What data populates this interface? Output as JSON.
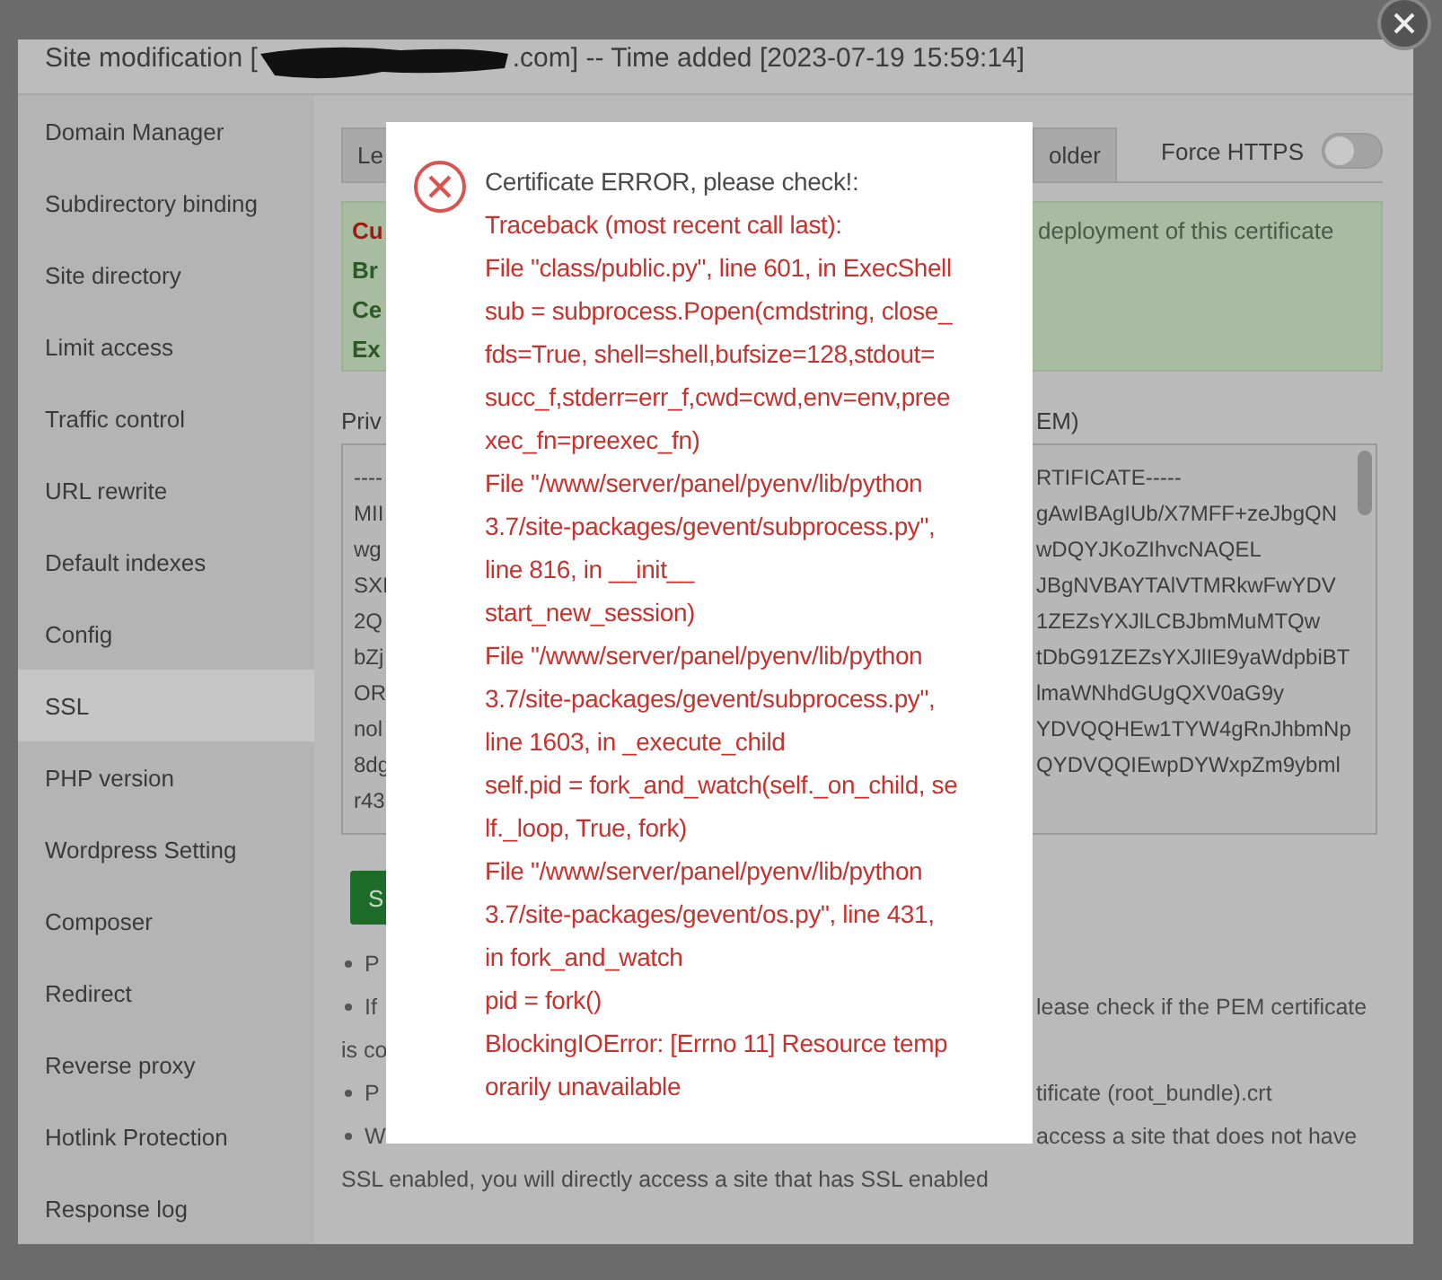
{
  "dialog": {
    "title_start": "Site modification [",
    "title_end": ".com] -- Time added [2023-07-19 15:59:14]"
  },
  "sidebar": {
    "items": [
      {
        "label": "Domain Manager",
        "selected": false
      },
      {
        "label": "Subdirectory binding",
        "selected": false
      },
      {
        "label": "Site directory",
        "selected": false
      },
      {
        "label": "Limit access",
        "selected": false
      },
      {
        "label": "Traffic control",
        "selected": false
      },
      {
        "label": "URL rewrite",
        "selected": false
      },
      {
        "label": "Default indexes",
        "selected": false
      },
      {
        "label": "Config",
        "selected": false
      },
      {
        "label": "SSL",
        "selected": true
      },
      {
        "label": "PHP version",
        "selected": false
      },
      {
        "label": "Wordpress Setting",
        "selected": false
      },
      {
        "label": "Composer",
        "selected": false
      },
      {
        "label": "Redirect",
        "selected": false
      },
      {
        "label": "Reverse proxy",
        "selected": false
      },
      {
        "label": "Hotlink Protection",
        "selected": false
      },
      {
        "label": "Response log",
        "selected": false
      }
    ]
  },
  "tabs": [
    {
      "label": "Le",
      "selected": false
    },
    {
      "label": "older",
      "selected": false
    }
  ],
  "force_https": {
    "label": "Force HTTPS",
    "on": false
  },
  "info_box": {
    "lines": [
      {
        "text": "Cu",
        "kind": "warning"
      },
      {
        "text": "Br",
        "kind": "normal"
      },
      {
        "text": "Ce",
        "kind": "normal"
      },
      {
        "text": "Ex",
        "kind": "normal"
      }
    ],
    "right_text": "deployment of this certificate"
  },
  "key_field": {
    "label": "Priv",
    "lines": [
      "----",
      "MII",
      "wg",
      "SXI",
      "2Q",
      "bZj",
      "OR",
      "nol",
      "8dg",
      "r43"
    ]
  },
  "certificate_field": {
    "label": "EM)",
    "lines": [
      "RTIFICATE-----",
      "gAwIBAgIUb/X7MFF+zeJbgQN",
      "wDQYJKoZIhvcNAQEL",
      "JBgNVBAYTAlVTMRkwFwYDV",
      "1ZEZsYXJlLCBJbmMuMTQw",
      "tDbG91ZEZsYXJlIE9yaWdpbiBT",
      "lmaWNhdGUgQXV0aG9y",
      "YDVQQHEw1TYW4gRnJhbmNp",
      "QYDVQQIEwpDYWxpZm9ybml"
    ]
  },
  "save_button": "S",
  "notes": [
    {
      "lines": [
        {
          "left": "P"
        }
      ]
    },
    {
      "lines": [
        {
          "left": "If",
          "right": "lease check if the PEM certificate"
        },
        {
          "left": "is co"
        }
      ]
    },
    {
      "lines": [
        {
          "left": "P",
          "right": "tificate (root_bundle).crt"
        }
      ]
    },
    {
      "lines": [
        {
          "left": "W",
          "right": "access a site that does not have"
        },
        {
          "full": "SSL enabled, you will directly access a site that has SSL enabled"
        }
      ]
    }
  ],
  "error_popup": {
    "title": "Certificate ERROR, please check!:",
    "lines": [
      "Traceback (most recent call last):",
      "File \"class/public.py\", line 601, in ExecShell",
      "sub = subprocess.Popen(cmdstring, close_",
      "fds=True, shell=shell,bufsize=128,stdout=",
      "succ_f,stderr=err_f,cwd=cwd,env=env,pree",
      "xec_fn=preexec_fn)",
      "File \"/www/server/panel/pyenv/lib/python",
      "3.7/site-packages/gevent/subprocess.py\",",
      "line 816, in __init__",
      "start_new_session)",
      "File \"/www/server/panel/pyenv/lib/python",
      "3.7/site-packages/gevent/subprocess.py\",",
      "line 1603, in _execute_child",
      "self.pid = fork_and_watch(self._on_child, se",
      "lf._loop, True, fork)",
      "File \"/www/server/panel/pyenv/lib/python",
      "3.7/site-packages/gevent/os.py\", line 431,",
      "in fork_and_watch",
      "pid = fork()",
      "BlockingIOError: [Errno 11] Resource temp",
      "orarily unavailable"
    ]
  }
}
